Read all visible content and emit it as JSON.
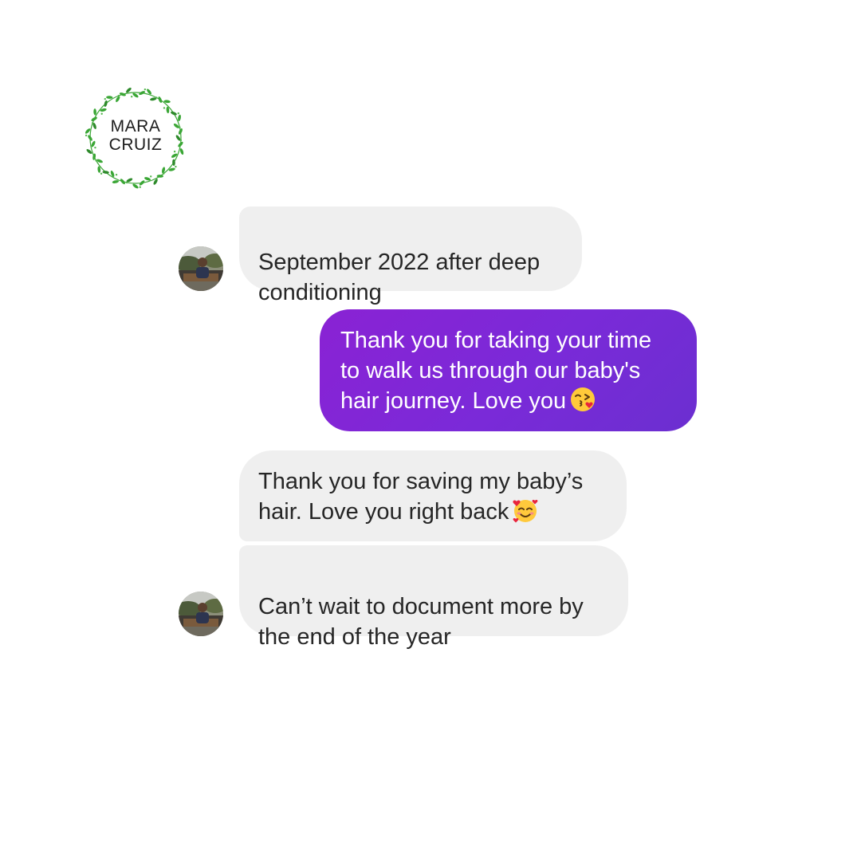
{
  "brand": {
    "line1": "MARA",
    "line2": "CRUIZ",
    "wreath_color": "#3aa635"
  },
  "messages": [
    {
      "sender": "other",
      "text": "September 2022 after deep\nconditioning"
    },
    {
      "sender": "me",
      "text": "Thank you for taking your time\nto walk us through our baby's\nhair journey. Love you",
      "emoji": "kissing-heart-emoji"
    },
    {
      "sender": "other",
      "text": "Thank you for saving my baby’s\nhair. Love you right back",
      "emoji": "smiling-face-with-hearts-emoji"
    },
    {
      "sender": "other",
      "text": "Can’t wait to document more by\nthe end of the year"
    }
  ],
  "colors": {
    "incoming_bubble": "#efefef",
    "outgoing_bubble": "#8a22d4",
    "incoming_text": "#262626",
    "outgoing_text": "#ffffff"
  }
}
